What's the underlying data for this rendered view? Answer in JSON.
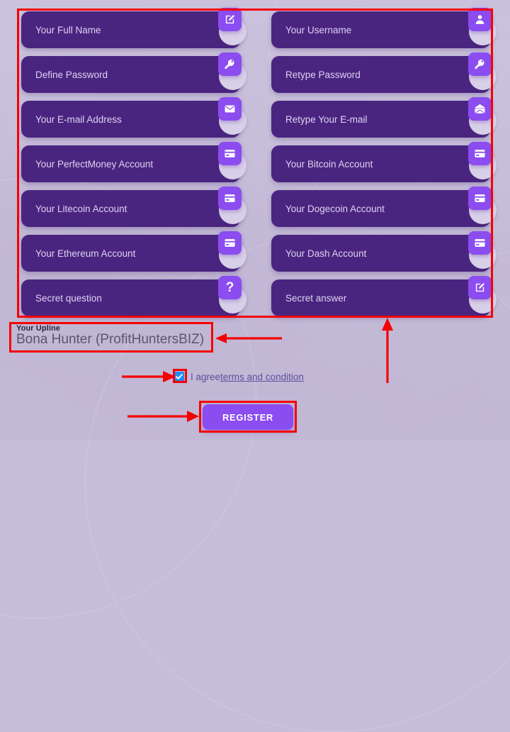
{
  "page": {
    "background_color": "#c6bdd9",
    "field_color": "#4a2580",
    "accent_color": "#8b4cf0",
    "annotation_color": "#f50000"
  },
  "form": {
    "rows": [
      [
        {
          "placeholder": "Your Full Name",
          "icon": "edit-square-icon",
          "name": "full-name"
        },
        {
          "placeholder": "Your Username",
          "icon": "user-icon",
          "name": "username"
        }
      ],
      [
        {
          "placeholder": "Define Password",
          "icon": "key-icon",
          "name": "define-password"
        },
        {
          "placeholder": "Retype Password",
          "icon": "key-icon",
          "name": "retype-password"
        }
      ],
      [
        {
          "placeholder": "Your E-mail Address",
          "icon": "envelope-icon",
          "name": "email-address"
        },
        {
          "placeholder": "Retype Your E-mail",
          "icon": "envelope-open-icon",
          "name": "retype-email"
        }
      ],
      [
        {
          "placeholder": "Your PerfectMoney Account",
          "icon": "card-icon",
          "name": "perfectmoney-account"
        },
        {
          "placeholder": "Your Bitcoin Account",
          "icon": "card-icon",
          "name": "bitcoin-account"
        }
      ],
      [
        {
          "placeholder": "Your Litecoin Account",
          "icon": "card-icon",
          "name": "litecoin-account"
        },
        {
          "placeholder": "Your Dogecoin Account",
          "icon": "card-icon",
          "name": "dogecoin-account"
        }
      ],
      [
        {
          "placeholder": "Your Ethereum Account",
          "icon": "card-icon",
          "name": "ethereum-account"
        },
        {
          "placeholder": "Your Dash Account",
          "icon": "card-icon",
          "name": "dash-account"
        }
      ],
      [
        {
          "placeholder": "Secret question",
          "icon": "question-mark-icon",
          "name": "secret-question"
        },
        {
          "placeholder": "Secret answer",
          "icon": "edit-square-icon",
          "name": "secret-answer"
        }
      ]
    ]
  },
  "upline": {
    "label": "Your Upline",
    "value": "Bona Hunter (ProfitHuntersBIZ)"
  },
  "agreement": {
    "checked": true,
    "text": "I agree",
    "link_text": "terms and condition"
  },
  "submit": {
    "label": "REGISTER"
  }
}
